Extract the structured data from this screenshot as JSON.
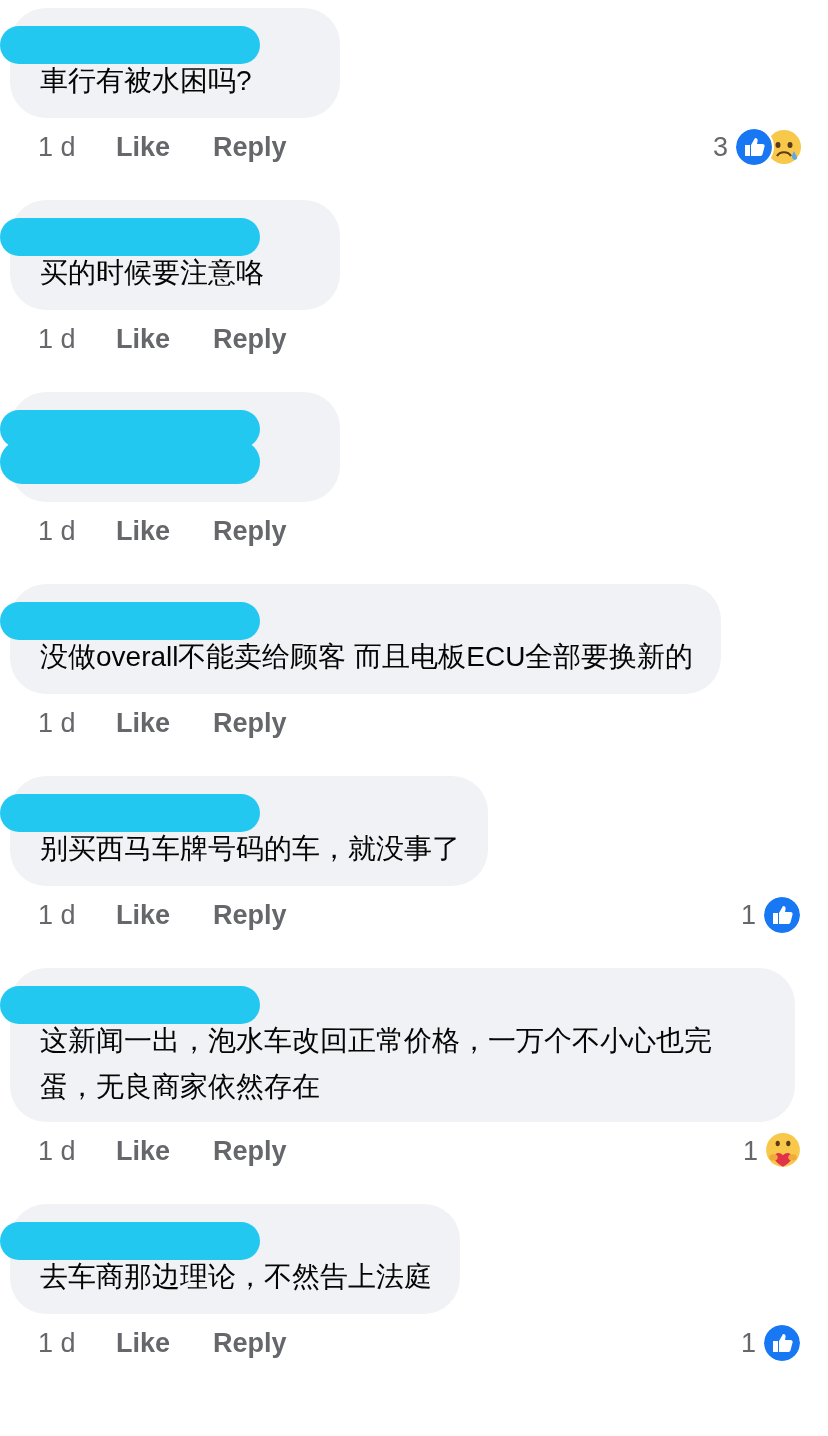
{
  "comments": [
    {
      "text": "車行有被水困吗?",
      "time": "1 d",
      "like": "Like",
      "reply": "Reply",
      "reactions": {
        "count": "3",
        "types": [
          {
            "kind": "like"
          },
          {
            "kind": "sad"
          }
        ]
      }
    },
    {
      "text": "买的时候要注意咯",
      "time": "1 d",
      "like": "Like",
      "reply": "Reply"
    },
    {
      "time": "1 d",
      "like": "Like",
      "reply": "Reply"
    },
    {
      "text": "没做overall不能卖给顾客 而且电板ECU全部要换新的",
      "time": "1 d",
      "like": "Like",
      "reply": "Reply"
    },
    {
      "text": "别买西马车牌号码的车，就没事了",
      "time": "1 d",
      "like": "Like",
      "reply": "Reply",
      "reactions": {
        "count": "1",
        "types": [
          {
            "kind": "like"
          }
        ]
      }
    },
    {
      "text": "这新闻一出，泡水车改回正常价格，一万个不小心也完蛋，无良商家依然存在",
      "time": "1 d",
      "like": "Like",
      "reply": "Reply",
      "reactions": {
        "count": "1",
        "types": [
          {
            "kind": "care"
          }
        ]
      }
    },
    {
      "text": "去车商那边理论，不然告上法庭",
      "time": "1 d",
      "like": "Like",
      "reply": "Reply",
      "reactions": {
        "count": "1",
        "types": [
          {
            "kind": "like"
          }
        ]
      }
    }
  ]
}
